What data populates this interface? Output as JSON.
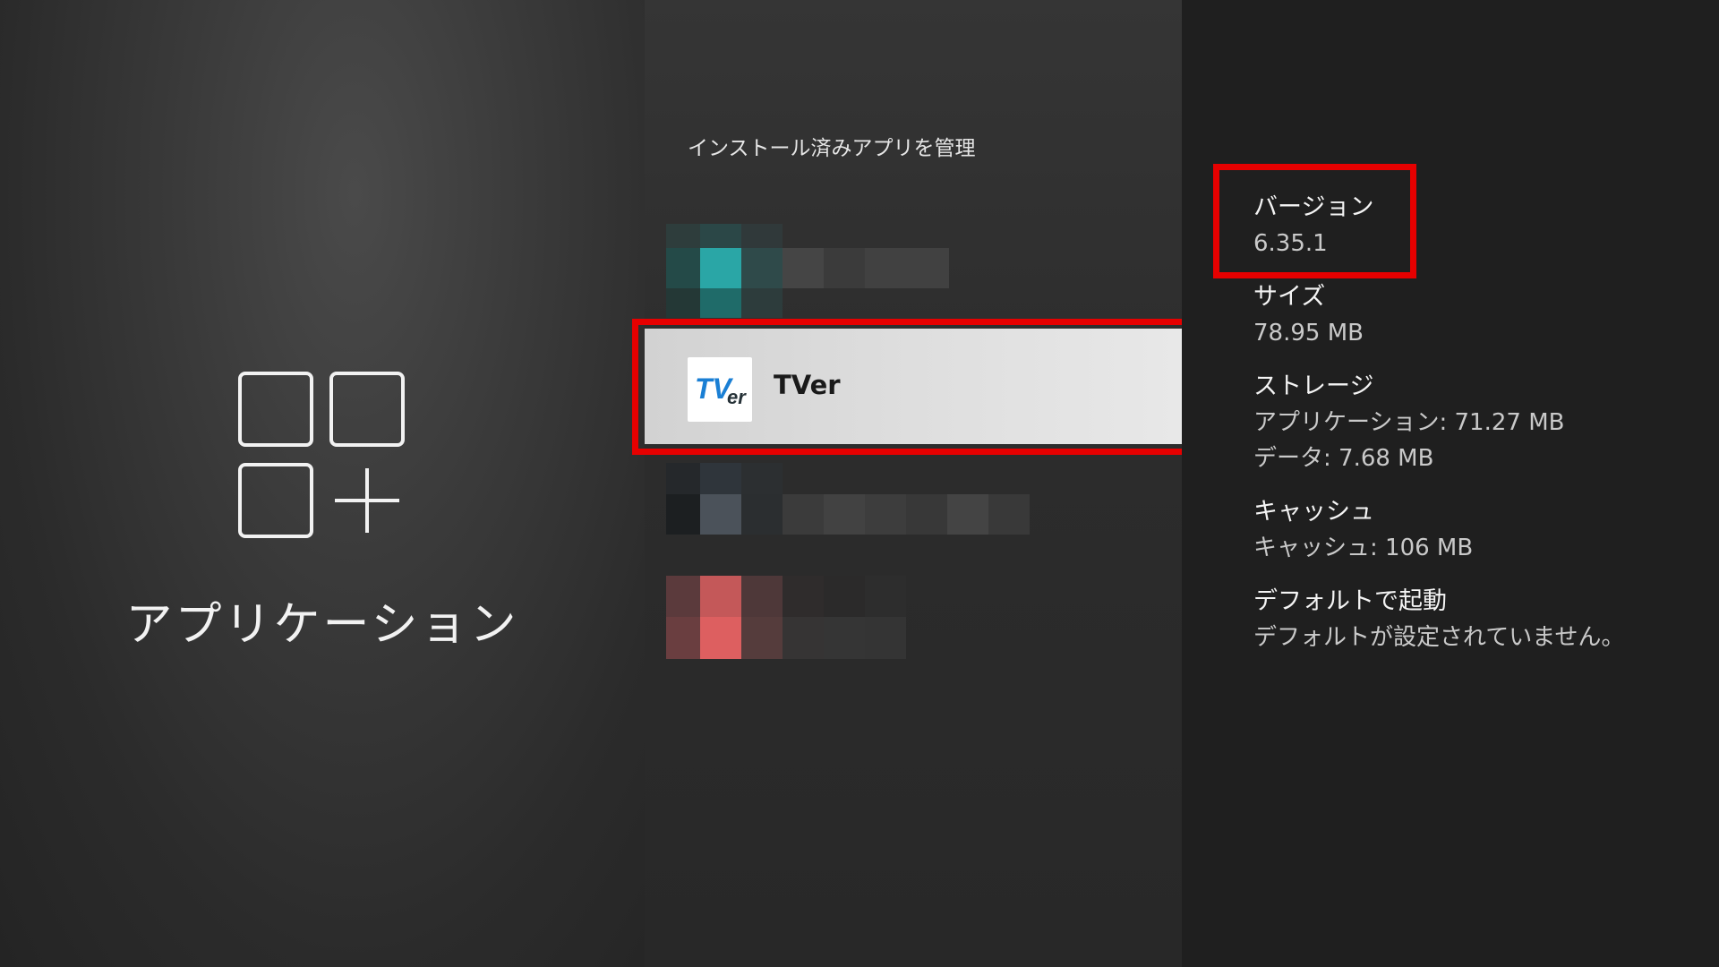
{
  "category": {
    "title": "アプリケーション",
    "icon": "apps-add-icon"
  },
  "list": {
    "heading": "インストール済みアプリを管理",
    "selected_app": {
      "name": "TVer",
      "icon": "tver-logo",
      "logo_text_main": "TV",
      "logo_text_sub": "er"
    }
  },
  "details": {
    "version": {
      "label": "バージョン",
      "value": "6.35.1"
    },
    "size": {
      "label": "サイズ",
      "value": "78.95 MB"
    },
    "storage": {
      "label": "ストレージ",
      "app_value": "アプリケーション: 71.27 MB",
      "data_value": "データ: 7.68 MB"
    },
    "cache": {
      "label": "キャッシュ",
      "value": "キャッシュ: 106 MB"
    },
    "default_launch": {
      "label": "デフォルトで起動",
      "value": "デフォルトが設定されていません。"
    }
  },
  "colors": {
    "highlight": "#e60000",
    "tver_blue": "#1a7fd4"
  }
}
